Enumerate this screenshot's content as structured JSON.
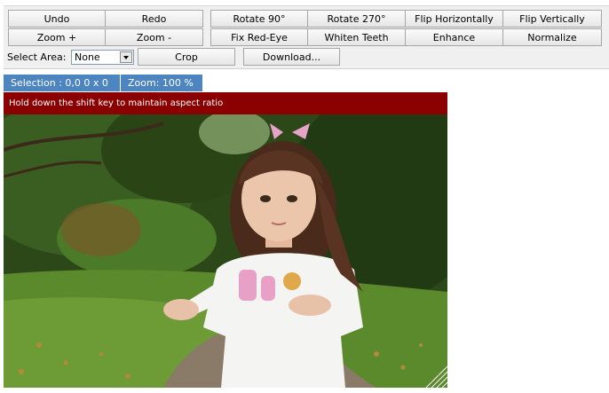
{
  "toolbar": {
    "row1": [
      "Undo",
      "Redo",
      "Rotate 90°",
      "Rotate 270°",
      "Flip Horizontally",
      "Flip Vertically"
    ],
    "row2": [
      "Zoom +",
      "Zoom -",
      "Fix Red-Eye",
      "Whiten Teeth",
      "Enhance",
      "Normalize"
    ],
    "select_area_label": "Select Area:",
    "select_area_value": "None",
    "crop": "Crop",
    "download": "Download..."
  },
  "status": {
    "selection": "Selection : 0,0 0 x 0",
    "zoom": "Zoom: 100 %"
  },
  "hint": "Hold down the shift key to maintain aspect ratio",
  "image": {
    "subject": "photo-girl-in-park",
    "colors": {
      "foliage_dark": "#223a14",
      "foliage": "#3f6b24",
      "grass": "#5e8f2e",
      "path": "#8a7a68",
      "shirt": "#f4f4f2",
      "skin": "#e8c2a8",
      "hair": "#5a3422",
      "bow": "#e7a2c8"
    }
  },
  "colors": {
    "status_bg": "#4d85c1",
    "hint_bg": "#8b0000",
    "toolbar_bg": "#f0f0f0"
  }
}
